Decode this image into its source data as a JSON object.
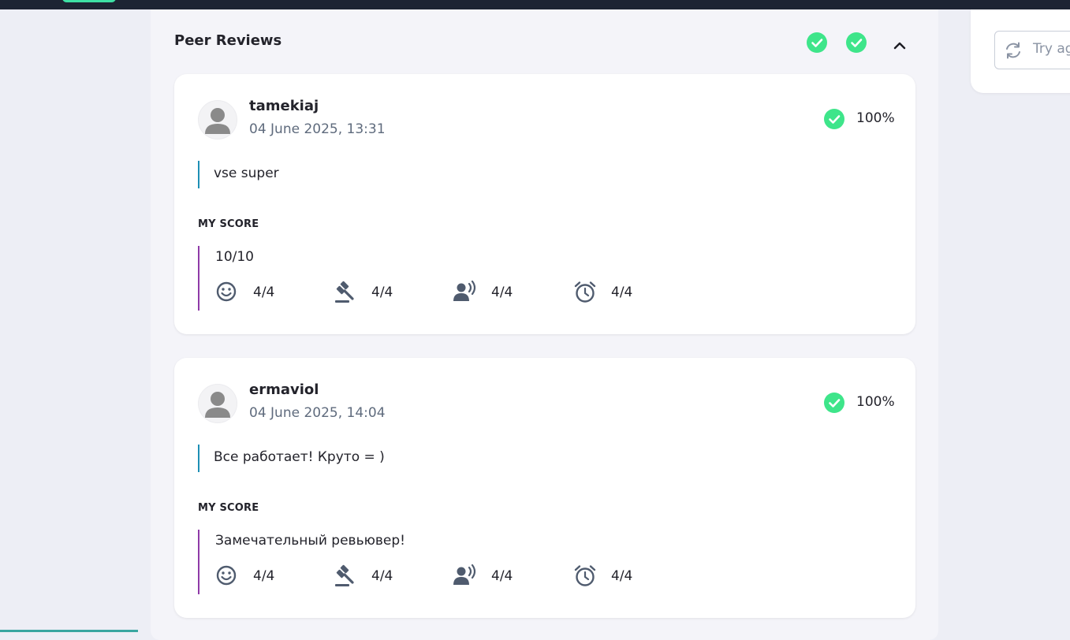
{
  "header": {
    "title": "Peer Reviews",
    "colors": {
      "success": "#3ee58a",
      "comment_accent": "#1e8fb5",
      "score_accent": "#8e3aa8"
    }
  },
  "side_panel": {
    "retry_label": "Try ag",
    "retry_icon": "refresh-icon"
  },
  "reviews": [
    {
      "name": "tamekiaj",
      "date": "04 June 2025, 13:31",
      "percent": "100%",
      "comment": "vse super",
      "my_score_label": "MY SCORE",
      "score_text": "10/10",
      "criteria": [
        {
          "icon": "smile-icon",
          "value": "4/4"
        },
        {
          "icon": "gavel-icon",
          "value": "4/4"
        },
        {
          "icon": "speaker-icon",
          "value": "4/4"
        },
        {
          "icon": "alarm-clock-icon",
          "value": "4/4"
        }
      ]
    },
    {
      "name": "ermaviol",
      "date": "04 June 2025, 14:04",
      "percent": "100%",
      "comment": "Все работает! Круто = )",
      "my_score_label": "MY SCORE",
      "score_text": "Замечательный ревьювер!",
      "criteria": [
        {
          "icon": "smile-icon",
          "value": "4/4"
        },
        {
          "icon": "gavel-icon",
          "value": "4/4"
        },
        {
          "icon": "speaker-icon",
          "value": "4/4"
        },
        {
          "icon": "alarm-clock-icon",
          "value": "4/4"
        }
      ]
    }
  ]
}
